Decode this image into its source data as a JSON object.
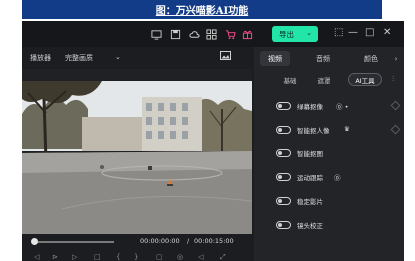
{
  "caption": "图：万兴喵影AI功能",
  "titlebar": {
    "export_label": "导出",
    "icons": [
      "monitor-icon",
      "save-icon",
      "cloud-icon",
      "grid-icon",
      "cart-icon",
      "gift-icon"
    ],
    "window_controls": [
      "⬚",
      "—",
      "□",
      "✕"
    ]
  },
  "player": {
    "label": "播放器",
    "quality": "完整画质",
    "current_time": "00:00:00:00",
    "separator": "/",
    "total_time": "00:00:15:00"
  },
  "panel": {
    "tabs": [
      "视频",
      "音频",
      "颜色"
    ],
    "subtabs": [
      "基础",
      "遮罩",
      "AI工具"
    ],
    "items": [
      {
        "label": "绿幕抠像",
        "on": false
      },
      {
        "label": "智能抠人像",
        "on": false
      },
      {
        "label": "智能抠图",
        "on": false
      },
      {
        "label": "运动跟踪",
        "on": false
      },
      {
        "label": "稳定影片",
        "on": false
      },
      {
        "label": "镜头校正",
        "on": false
      }
    ]
  },
  "colors": {
    "caption_bg": "#123c87",
    "app_bg": "#1c1d21",
    "accent": "#22e6a8",
    "cart_pink": "#ff4f8b"
  }
}
